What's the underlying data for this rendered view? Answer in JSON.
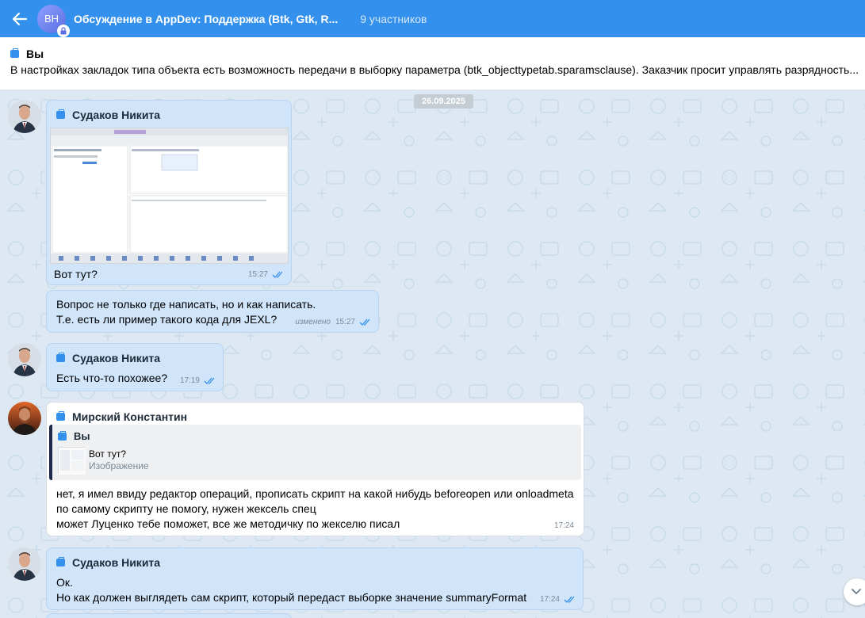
{
  "header": {
    "avatar_initials": "ВН",
    "title": "Обсуждение в AppDev: Поддержка (Btk, Gtk, R...",
    "members": "9 участников"
  },
  "pinned": {
    "name": "Вы",
    "text": "В настройках закладок типа объекта есть возможность передачи в выборку параметра (btk_objecttypetab.sparamsclause). Заказчик просит управлять разрядность..."
  },
  "chat": {
    "date": "26.09.2025",
    "messages": [
      {
        "sender": "Судаков Никита",
        "text": "Вот тут?",
        "time": "15:27",
        "has_image": true
      },
      {
        "lines": [
          "Вопрос не только где написать, но и как написать.",
          "Т.е. есть ли пример такого кода для JEXL?"
        ],
        "edited": "изменено",
        "time": "15:27"
      },
      {
        "sender": "Судаков Никита",
        "text": "Есть что-то похожее?",
        "time": "17:19"
      },
      {
        "sender": "Мирский Константин",
        "reply": {
          "name": "Вы",
          "text": "Вот тут?",
          "sub": "Изображение"
        },
        "lines": [
          "нет, я имел ввиду редактор операций, прописать скрипт на какой нибудь beforeopen или onloadmeta",
          "по самому скрипту не помогу, нужен жексель спец",
          "может Луценко тебе поможет, все же методичку по жекселю писал"
        ],
        "time": "17:24"
      },
      {
        "sender": "Судаков Никита",
        "lines": [
          "Ок.",
          "Но как должен выглядеть сам скрипт, который передаст выборке значение summaryFormat"
        ],
        "time": "17:24"
      }
    ]
  },
  "colors": {
    "accent": "#3390ec",
    "bubble": "#d0e4fa",
    "chat_bg": "#dde8f2"
  }
}
